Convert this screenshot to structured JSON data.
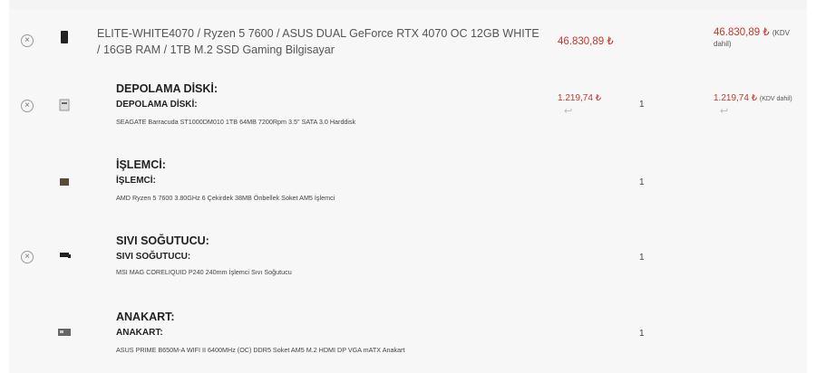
{
  "main_item": {
    "name": "ELITE-WHITE4070 / Ryzen 5 7600 / ASUS DUAL GeForce RTX 4070 OC 12GB WHITE / 16GB RAM / 1TB M.2 SSD Gaming Bilgisayar",
    "price": "46.830,89 ₺",
    "total": "46.830,89 ₺",
    "total_note": "(KDV dahil)"
  },
  "components": [
    {
      "heading": "DEPOLAMA DİSKİ:",
      "subheading": "DEPOLAMA DİSKİ:",
      "description": "SEAGATE Barracuda ST1000DM010 1TB 64MB 7200Rpm 3.5\" SATA 3.0 Harddisk",
      "price": "1.219,74 ₺",
      "quantity": "1",
      "total": "1.219,74 ₺",
      "total_note": "(KDV dahil)"
    },
    {
      "heading": "İŞLEMCİ:",
      "subheading": "İŞLEMCİ:",
      "description": "AMD Ryzen 5 7600 3.80GHz 6 Çekirdek 38MB Önbellek Soket AM5 İşlemci",
      "quantity": "1"
    },
    {
      "heading": "SIVI SOĞUTUCU:",
      "subheading": "SIVI SOĞUTUCU:",
      "description": "MSI MAG CORELIQUID P240 240mm İşlemci Sıvı Soğutucu",
      "quantity": "1"
    },
    {
      "heading": "ANAKART:",
      "subheading": "ANAKART:",
      "description": "ASUS PRIME B650M-A WIFI II 6400MHz (OC) DDR5 Soket AM5 M.2 HDMI DP VGA mATX Anakart",
      "quantity": "1"
    }
  ],
  "icons": {
    "remove": "close-circle-icon",
    "return": "return-arrow-icon"
  },
  "glyphs": {
    "remove": "×",
    "return": "↩"
  },
  "colors": {
    "price": "#c0392b",
    "background": "#f7f7f7"
  }
}
